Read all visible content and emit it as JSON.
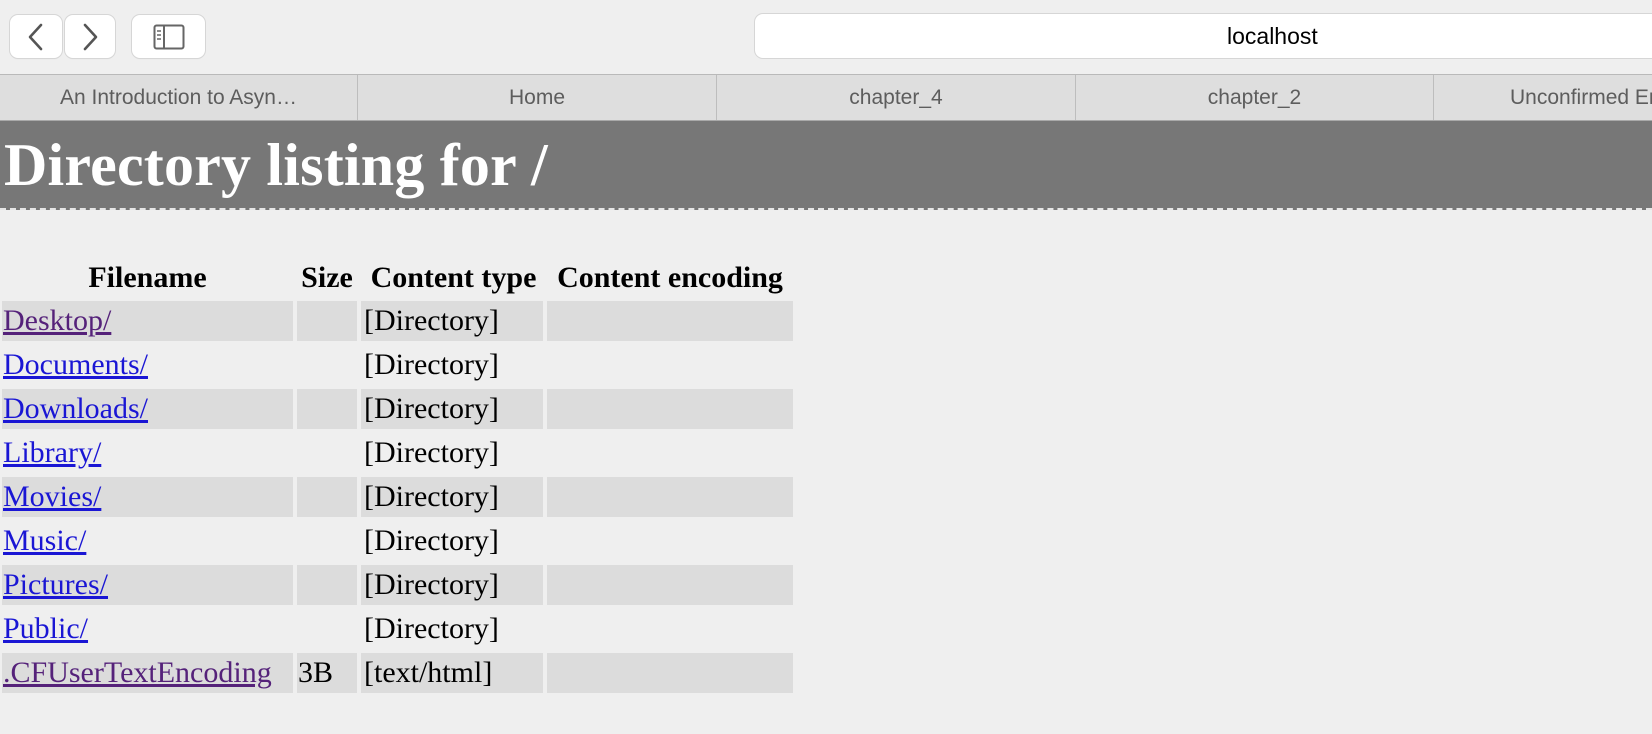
{
  "toolbar": {
    "back_icon": "chevron-left-icon",
    "forward_icon": "chevron-right-icon",
    "sidebar_icon": "sidebar-icon",
    "address": "localhost"
  },
  "tabs": [
    {
      "label": "An Introduction to Asyn…"
    },
    {
      "label": "Home"
    },
    {
      "label": "chapter_4"
    },
    {
      "label": "chapter_2"
    },
    {
      "label": "Unconfirmed Erra"
    }
  ],
  "page": {
    "heading": "Directory listing for /"
  },
  "listing": {
    "headers": {
      "filename": "Filename",
      "size": "Size",
      "content_type": "Content type",
      "content_encoding": "Content encoding"
    },
    "rows": [
      {
        "name": "Desktop/",
        "size": "",
        "type": "[Directory]",
        "encoding": "",
        "visited": true
      },
      {
        "name": "Documents/",
        "size": "",
        "type": "[Directory]",
        "encoding": "",
        "visited": false
      },
      {
        "name": "Downloads/",
        "size": "",
        "type": "[Directory]",
        "encoding": "",
        "visited": false
      },
      {
        "name": "Library/",
        "size": "",
        "type": "[Directory]",
        "encoding": "",
        "visited": false
      },
      {
        "name": "Movies/",
        "size": "",
        "type": "[Directory]",
        "encoding": "",
        "visited": false
      },
      {
        "name": "Music/",
        "size": "",
        "type": "[Directory]",
        "encoding": "",
        "visited": false
      },
      {
        "name": "Pictures/",
        "size": "",
        "type": "[Directory]",
        "encoding": "",
        "visited": false
      },
      {
        "name": "Public/",
        "size": "",
        "type": "[Directory]",
        "encoding": "",
        "visited": false
      },
      {
        "name": ".CFUserTextEncoding",
        "size": "3B",
        "type": "[text/html]",
        "encoding": "",
        "visited": true
      }
    ]
  },
  "colors": {
    "banner": "#777777",
    "link": "#1a16d4",
    "visited_link": "#55227a",
    "row_shade": "#dcdcdc"
  }
}
